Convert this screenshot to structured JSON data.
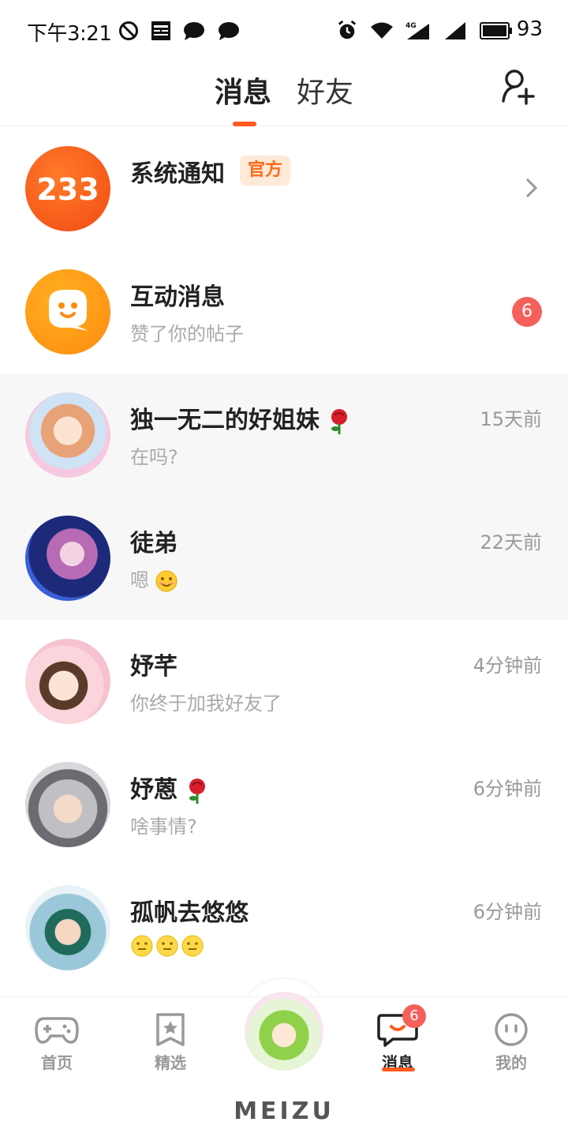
{
  "status_bar": {
    "time": "下午3:21",
    "battery": "93",
    "icons": [
      "do-not-disturb-icon",
      "news-icon",
      "chat-bubble-icon",
      "chat-bubble-icon",
      "alarm-icon",
      "wifi-icon",
      "signal-4g-icon",
      "signal-icon",
      "battery-icon"
    ],
    "network": "4G"
  },
  "header": {
    "tabs": [
      {
        "label": "消息",
        "active": true
      },
      {
        "label": "好友",
        "active": false
      }
    ],
    "accent": "#ff5a1f"
  },
  "conversations": [
    {
      "title": "系统通知",
      "badge": "官方",
      "subtitle": "",
      "time": "",
      "avatar_text": "233",
      "avatar_color": "#ff5a1f"
    },
    {
      "title": "互动消息",
      "subtitle": "赞了你的帖子",
      "time": "",
      "unread": "6",
      "avatar_color": "#ff9a1a"
    },
    {
      "title": "独一无二的好姐妹",
      "subtitle": "在吗?",
      "time": "15天前",
      "highlight": true
    },
    {
      "title": "徒弟",
      "subtitle": "嗯",
      "time": "22天前",
      "highlight": true
    },
    {
      "title": "妤芊",
      "subtitle": "你终于加我好友了",
      "time": "4分钟前"
    },
    {
      "title": "妤蒽",
      "subtitle": "啥事情?",
      "time": "6分钟前"
    },
    {
      "title": "孤帆去悠悠",
      "subtitle": "",
      "time": "6分钟前"
    }
  ],
  "tab_bar": {
    "items": [
      {
        "label": "首页",
        "icon": "gamepad-icon"
      },
      {
        "label": "精选",
        "icon": "star-bookmark-icon"
      },
      {
        "label": "",
        "icon": "center-avatar"
      },
      {
        "label": "消息",
        "icon": "message-icon",
        "badge": "6",
        "active": true
      },
      {
        "label": "我的",
        "icon": "face-icon"
      }
    ]
  },
  "device": {
    "brand": "MEIZU"
  }
}
